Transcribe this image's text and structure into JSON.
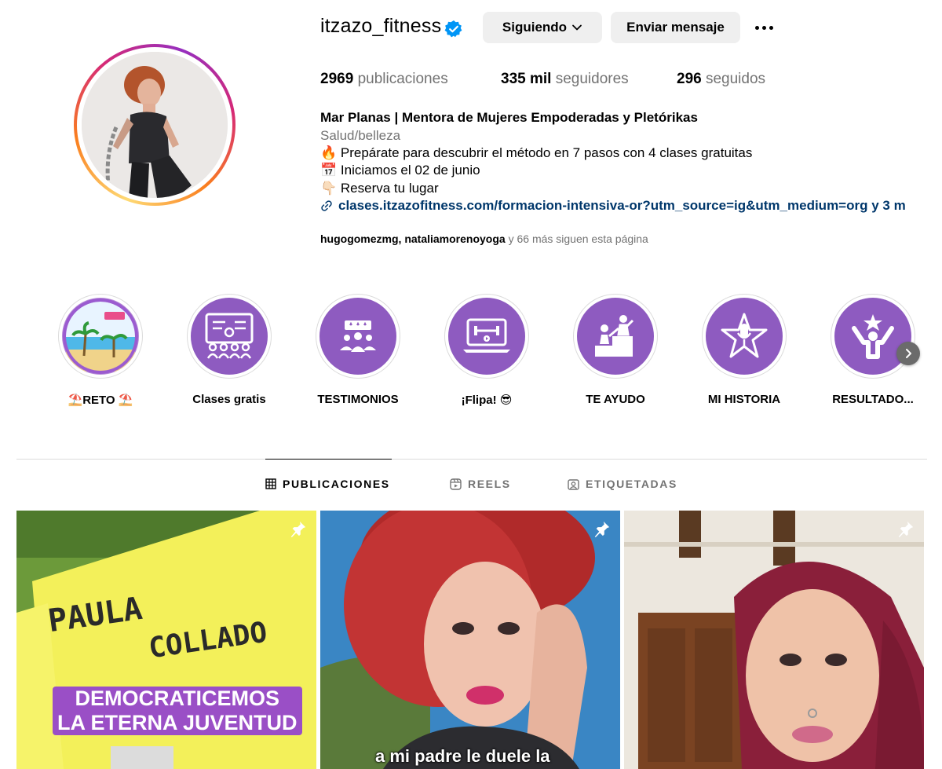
{
  "profile": {
    "username": "itzazo_fitness",
    "verified": true,
    "follow_button": "Siguiendo",
    "message_button": "Enviar mensaje",
    "stats": {
      "posts_value": "2969",
      "posts_label": "publicaciones",
      "followers_value": "335 mil",
      "followers_label": "seguidores",
      "following_value": "296",
      "following_label": "seguidos"
    },
    "bio": {
      "name": "Mar Planas | Mentora de Mujeres Empoderadas y Pletórikas",
      "category": "Salud/belleza",
      "line1": "🔥 Prepárate para descubrir el método en 7 pasos con 4 clases gratuitas",
      "line2": "📅 Iniciamos el 02 de junio",
      "line3": "👇🏻 Reserva tu lugar",
      "link": "clases.itzazofitness.com/formacion-intensiva-or?utm_source=ig&utm_medium=org y 3 m"
    },
    "followed_by": {
      "users": "hugogomezmg, nataliamorenoyoga",
      "rest": "y 66 más siguen esta página"
    }
  },
  "highlights": [
    {
      "label": "⛱️RETO ⛱️",
      "icon": "beach-icon"
    },
    {
      "label": "Clases gratis",
      "icon": "classroom-icon"
    },
    {
      "label": "TESTIMONIOS",
      "icon": "reviews-icon"
    },
    {
      "label": "¡Flipa! 😎",
      "icon": "laptop-fitness-icon"
    },
    {
      "label": "TE AYUDO",
      "icon": "help-step-icon"
    },
    {
      "label": "MI HISTORIA",
      "icon": "star-microphone-icon"
    },
    {
      "label": "RESULTADO...",
      "icon": "celebration-icon"
    }
  ],
  "tabs": [
    {
      "label": "PUBLICACIONES",
      "icon": "grid-icon",
      "active": true
    },
    {
      "label": "REELS",
      "icon": "reels-icon",
      "active": false
    },
    {
      "label": "ETIQUETADAS",
      "icon": "tagged-icon",
      "active": false
    }
  ],
  "posts": [
    {
      "pinned": true,
      "sign_first": "PAULA",
      "sign_last": "COLLADO",
      "caption_line1": "DEMOCRATICEMOS",
      "caption_line2": "LA ETERNA JUVENTUD"
    },
    {
      "pinned": true,
      "subtitle": "a mi padre le duele la"
    },
    {
      "pinned": true
    }
  ],
  "colors": {
    "accent_link": "#00376b",
    "highlight_purple": "#8e5bc0",
    "verified_blue": "#0095f6",
    "button_gray": "#efefef",
    "muted_text": "#737373"
  }
}
